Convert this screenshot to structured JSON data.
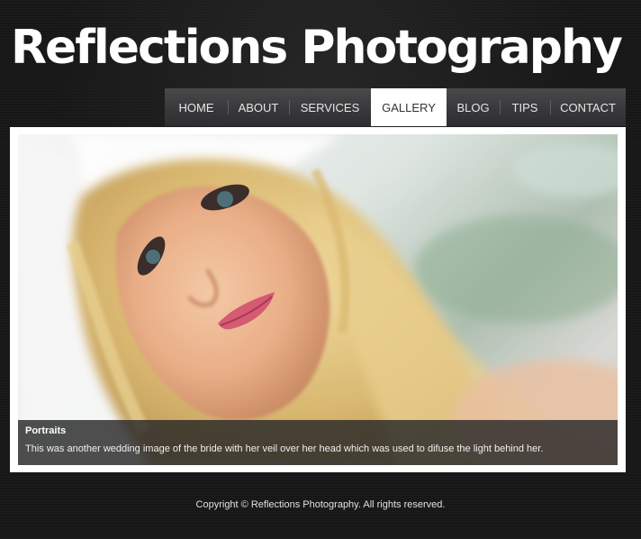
{
  "header": {
    "site_title": "Reflections Photography"
  },
  "nav": {
    "items": [
      {
        "label": "HOME",
        "active": false
      },
      {
        "label": "ABOUT",
        "active": false
      },
      {
        "label": "SERVICES",
        "active": false
      },
      {
        "label": "GALLERY",
        "active": true
      },
      {
        "label": "BLOG",
        "active": false
      },
      {
        "label": "TIPS",
        "active": false
      },
      {
        "label": "CONTACT",
        "active": false
      }
    ]
  },
  "gallery": {
    "caption_title": "Portraits",
    "caption_text": "This was another wedding image of the bride with her veil over her head which was used to difuse the light behind her."
  },
  "footer": {
    "copyright": "Copyright © Reflections Photography. All rights reserved."
  },
  "colors": {
    "background": "#171717",
    "nav_bg": "#3a3a3c",
    "nav_active_bg": "#ffffff",
    "nav_text": "#e6e6e6",
    "frame": "#ffffff"
  }
}
